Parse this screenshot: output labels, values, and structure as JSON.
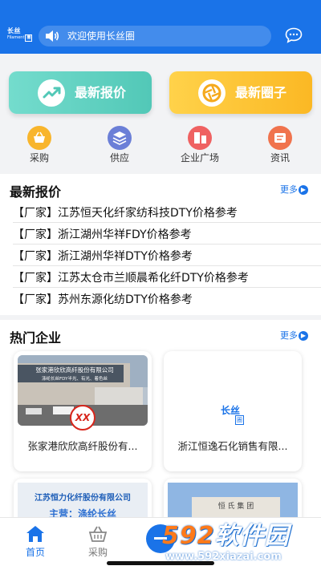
{
  "header": {
    "logo_main": "长丝",
    "logo_sub": "Filament",
    "logo_box": "圈",
    "notice_text": "欢迎使用长丝圈",
    "speaker_icon": "speaker-icon",
    "message_icon": "chat-bubble-icon",
    "bg_color": "#1a73e8"
  },
  "feature_cards": [
    {
      "label": "最新报价",
      "icon": "trend-up-icon",
      "color": "#5bcfbf"
    },
    {
      "label": "最新圈子",
      "icon": "aperture-icon",
      "color": "#fcc12e"
    }
  ],
  "categories": [
    {
      "label": "采购",
      "icon": "basket-icon",
      "color": "#f8b52c"
    },
    {
      "label": "供应",
      "icon": "layers-icon",
      "color": "#6b7fd7"
    },
    {
      "label": "企业广场",
      "icon": "building-icon",
      "color": "#ef6161"
    },
    {
      "label": "资讯",
      "icon": "news-icon",
      "color": "#f0734d"
    }
  ],
  "latest_quotes": {
    "title": "最新报价",
    "more": "更多",
    "items": [
      "【厂家】江苏恒天化纤家纺科技DTY价格参考",
      "【厂家】浙江湖州华祥FDY价格参考",
      "【厂家】浙江湖州华祥DTY价格参考",
      "【厂家】江苏太仓市兰顺晨希化纤DTY价格参考",
      "【厂家】苏州东源化纺DTY价格参考"
    ]
  },
  "hot_companies": {
    "title": "热门企业",
    "more": "更多",
    "items": [
      {
        "name": "张家港欣欣高纤股份有...",
        "sign": "张家港欣欣高纤股份有限公司",
        "sign2": "涤纶长丝FDY半光、有光、着色丝",
        "logo": "XX"
      },
      {
        "name": "浙江恒逸石化销售有限...",
        "logo_main": "长丝",
        "logo_box": "圈"
      },
      {
        "sign": "江苏恒力化纤股份有限公司",
        "sign2": "主营：涤纶长丝"
      },
      {
        "sign": "恒 氏 集 团"
      }
    ]
  },
  "tabbar": [
    {
      "label": "首页",
      "icon": "home-icon",
      "active": true
    },
    {
      "label": "采购",
      "icon": "basket-icon",
      "active": false
    },
    {
      "label": "",
      "icon": "plus-icon",
      "active": false
    }
  ],
  "watermark": {
    "number": "592",
    "text": "软件园",
    "url": "www.592xiazai.com"
  }
}
